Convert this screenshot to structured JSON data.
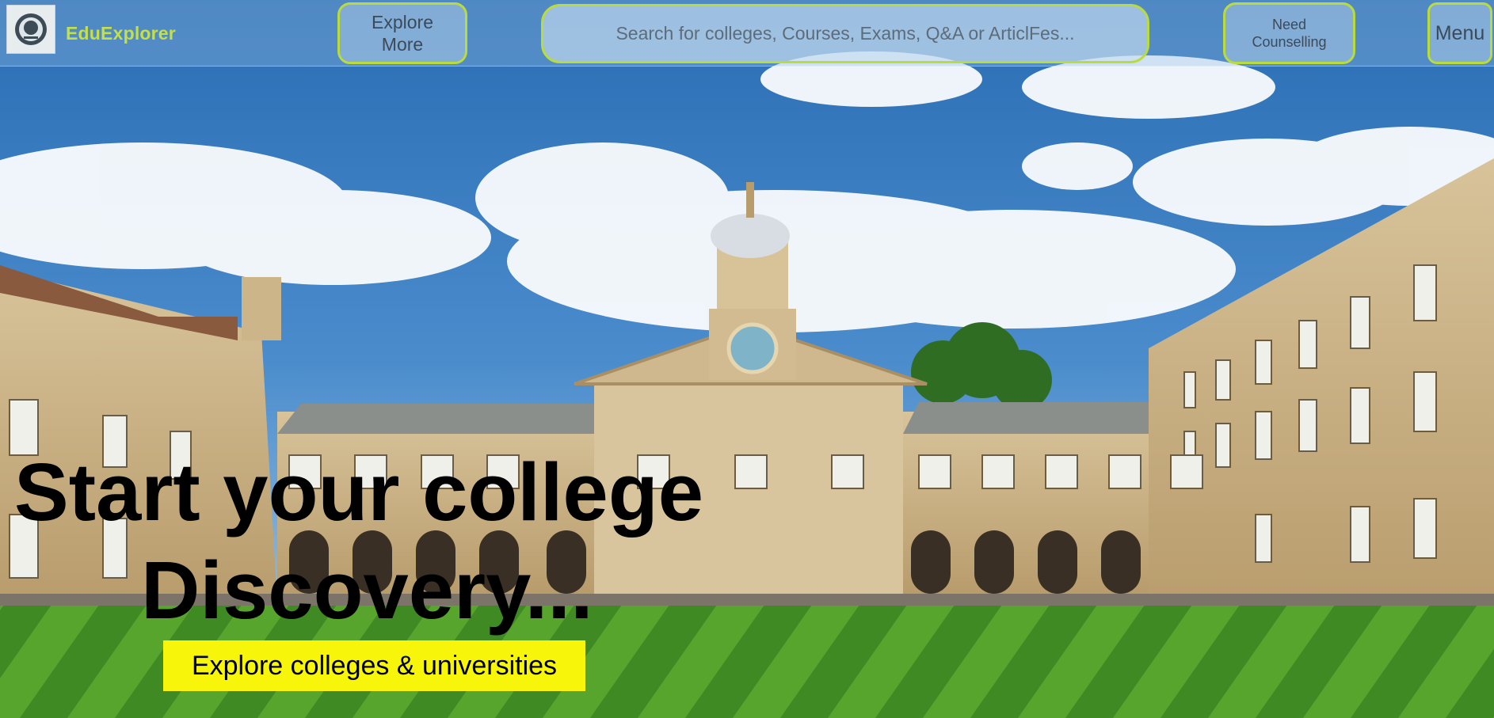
{
  "header": {
    "brand_name": "EduExplorer",
    "explore_label": "Explore More",
    "search_placeholder": "Search for colleges, Courses, Exams, Q&A or ArticlFes...",
    "counselling_label": "Need Counselling",
    "menu_label": "Menu"
  },
  "hero": {
    "title_line1": "Start your college",
    "title_line2": "Discovery...",
    "cta_label": "Explore colleges & universities"
  },
  "colors": {
    "accent": "#b9dc3c",
    "brand_text": "#c3e04a",
    "cta_background": "#f6f50a",
    "sky": "#2f74b9",
    "lawn": "#4f9a2a"
  },
  "icons": {
    "logo": "college-crest-icon"
  }
}
